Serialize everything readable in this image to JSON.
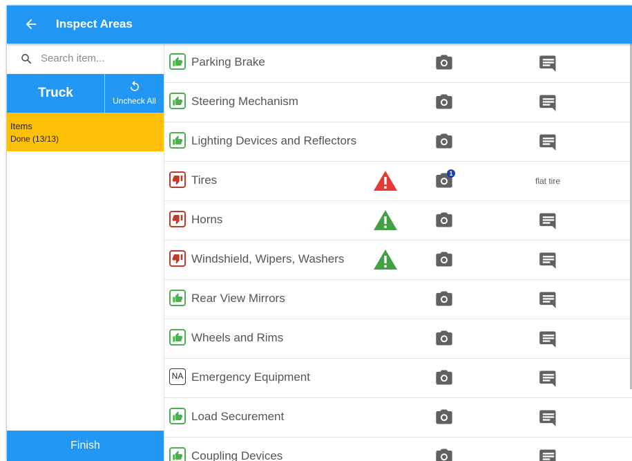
{
  "header": {
    "title": "Inspect Areas"
  },
  "sidebar": {
    "search_placeholder": "Search item...",
    "tab_truck": "Truck",
    "tab_uncheck": "Uncheck All",
    "items_label": "Items",
    "items_status": "Done (13/13)",
    "finish_label": "Finish"
  },
  "colors": {
    "primary": "#2196f3",
    "accent_yellow": "#ffc107",
    "pass_green": "#4caf50",
    "fail_red": "#c0392b",
    "warn_red": "#e53935",
    "warn_green": "#43a047"
  },
  "items": [
    {
      "name": "Parking Brake",
      "status": "pass",
      "status_icon": "thumbs-up-icon",
      "warning": "",
      "photo_count": "",
      "comment": ""
    },
    {
      "name": "Steering Mechanism",
      "status": "pass",
      "status_icon": "thumbs-up-icon",
      "warning": "",
      "photo_count": "",
      "comment": ""
    },
    {
      "name": "Lighting Devices and Reflectors",
      "status": "pass",
      "status_icon": "thumbs-up-icon",
      "warning": "",
      "photo_count": "",
      "comment": ""
    },
    {
      "name": "Tires",
      "status": "fail",
      "status_icon": "thumbs-down-icon",
      "warning": "red",
      "photo_count": "1",
      "comment": "flat tire"
    },
    {
      "name": "Horns",
      "status": "fail",
      "status_icon": "thumbs-down-icon",
      "warning": "green",
      "photo_count": "",
      "comment": ""
    },
    {
      "name": "Windshield, Wipers, Washers",
      "status": "fail",
      "status_icon": "thumbs-down-icon",
      "warning": "green",
      "photo_count": "",
      "comment": ""
    },
    {
      "name": "Rear View Mirrors",
      "status": "pass",
      "status_icon": "thumbs-up-icon",
      "warning": "",
      "photo_count": "",
      "comment": ""
    },
    {
      "name": "Wheels and Rims",
      "status": "pass",
      "status_icon": "thumbs-up-icon",
      "warning": "",
      "photo_count": "",
      "comment": ""
    },
    {
      "name": "Emergency Equipment",
      "status": "na",
      "status_icon": "na-icon",
      "status_text": "NA",
      "warning": "",
      "photo_count": "",
      "comment": ""
    },
    {
      "name": "Load Securement",
      "status": "pass",
      "status_icon": "thumbs-up-icon",
      "warning": "",
      "photo_count": "",
      "comment": ""
    },
    {
      "name": "Coupling Devices",
      "status": "pass",
      "status_icon": "thumbs-up-icon",
      "warning": "",
      "photo_count": "",
      "comment": ""
    }
  ]
}
